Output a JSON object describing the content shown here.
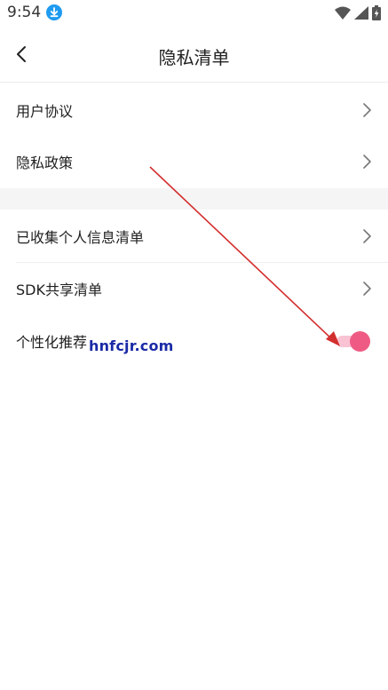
{
  "status_bar": {
    "time": "9:54",
    "icons": [
      "download-icon",
      "wifi-icon",
      "signal-icon",
      "battery-charging-icon"
    ]
  },
  "header": {
    "title": "隐私清单",
    "back_icon": "back-icon"
  },
  "sections": [
    {
      "items": [
        {
          "label": "用户协议",
          "icon": "chevron-right-icon"
        },
        {
          "label": "隐私政策",
          "icon": "chevron-right-icon"
        }
      ]
    },
    {
      "items": [
        {
          "label": "已收集个人信息清单",
          "icon": "chevron-right-icon"
        },
        {
          "label": "SDK共享清单",
          "icon": "chevron-right-icon"
        },
        {
          "label": "个性化推荐",
          "toggle": true,
          "toggle_on": true
        }
      ]
    }
  ],
  "watermark": "hnfcjr.com",
  "colors": {
    "accent": "#ef5a84",
    "toggle_track": "#f9c3d3",
    "download_badge": "#1e9bf0",
    "annotation_arrow": "#d32f2f",
    "watermark": "#1a2aa6"
  }
}
